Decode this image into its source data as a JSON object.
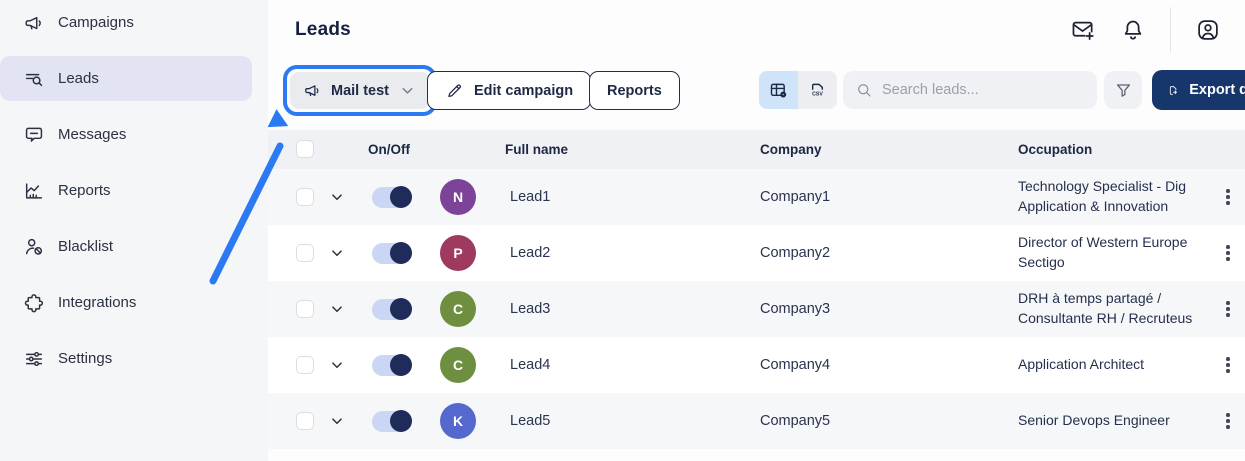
{
  "sidebar": {
    "items": [
      {
        "label": "Campaigns",
        "icon": "megaphone-icon",
        "active": false
      },
      {
        "label": "Leads",
        "icon": "lead-search-icon",
        "active": true
      },
      {
        "label": "Messages",
        "icon": "message-icon",
        "active": false
      },
      {
        "label": "Reports",
        "icon": "chart-icon",
        "active": false
      },
      {
        "label": "Blacklist",
        "icon": "user-block-icon",
        "active": false
      },
      {
        "label": "Integrations",
        "icon": "puzzle-icon",
        "active": false
      },
      {
        "label": "Settings",
        "icon": "sliders-icon",
        "active": false
      }
    ]
  },
  "header": {
    "title": "Leads",
    "icons": [
      "mail-plus-icon",
      "bell-icon",
      "account-icon"
    ]
  },
  "toolbar": {
    "campaign_dropdown": {
      "label": "Mail test",
      "icon": "megaphone-icon",
      "highlighted": true
    },
    "edit_campaign_label": "Edit campaign",
    "reports_label": "Reports",
    "view_toggle": [
      "table-view-icon",
      "csv-export-icon"
    ],
    "search": {
      "placeholder": "Search leads..."
    },
    "export_label": "Export data"
  },
  "table": {
    "headers": {
      "on_off": "On/Off",
      "full_name": "Full name",
      "company": "Company",
      "occupation": "Occupation"
    },
    "rows": [
      {
        "name": "Lead1",
        "company": "Company1",
        "enabled": true,
        "occupation": [
          "Technology Specialist - Dig",
          "Application & Innovation"
        ],
        "avatar": {
          "letter": "N",
          "color": "#7d4398"
        }
      },
      {
        "name": "Lead2",
        "company": "Company2",
        "enabled": true,
        "occupation": [
          "Director of Western Europe",
          "Sectigo"
        ],
        "avatar": {
          "letter": "P",
          "color": "#9e3a60"
        }
      },
      {
        "name": "Lead3",
        "company": "Company3",
        "enabled": true,
        "occupation": [
          "DRH à temps partagé /",
          "Consultante RH / Recruteus"
        ],
        "avatar": {
          "letter": "C",
          "color": "#6d8f3f"
        }
      },
      {
        "name": "Lead4",
        "company": "Company4",
        "enabled": true,
        "occupation": [
          "Application Architect"
        ],
        "avatar": {
          "letter": "C",
          "color": "#6d8f3f"
        }
      },
      {
        "name": "Lead5",
        "company": "Company5",
        "enabled": true,
        "occupation": [
          "Senior Devops Engineer"
        ],
        "avatar": {
          "letter": "K",
          "color": "#5468cd"
        }
      }
    ]
  },
  "annotation": {
    "type": "highlight-ring-and-arrow",
    "target": "campaign-dropdown",
    "color": "#2b7af4"
  },
  "colors": {
    "primary_navy": "#16366c",
    "selected_nav": "#e2e4f3",
    "toggle_on_knob": "#1f2c5a",
    "active_view_toggle": "#cfe4f9"
  }
}
